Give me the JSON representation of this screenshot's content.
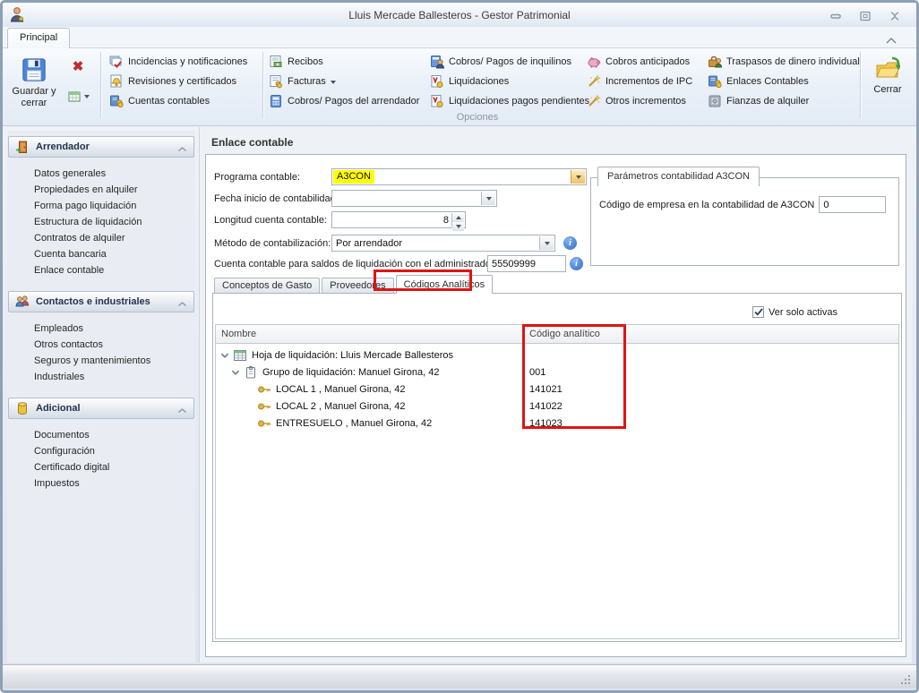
{
  "window": {
    "title": "Lluis Mercade Ballesteros - Gestor Patrimonial",
    "tab_label": "Principal"
  },
  "ribbon": {
    "save_label": "Guardar y cerrar",
    "close_label": "Cerrar",
    "group_label": "Opciones",
    "items": {
      "col_a": [
        "Incidencias y notificaciones",
        "Revisiones y certificados",
        "Cuentas contables"
      ],
      "col_b": [
        "Recibos",
        "Facturas",
        "Cobros/ Pagos del arrendador"
      ],
      "col_c": [
        "Cobros/ Pagos de inquilinos",
        "Liquidaciones",
        "Liquidaciones pagos pendientes"
      ],
      "col_d": [
        "Cobros anticipados",
        "Incrementos de IPC",
        "Otros incrementos"
      ],
      "col_e": [
        "Traspasos de dinero individual",
        "Enlaces Contables",
        "Fianzas de alquiler"
      ]
    }
  },
  "sidebar": {
    "groups": [
      {
        "label": "Arrendador",
        "items": [
          "Datos generales",
          "Propiedades en alquiler",
          "Forma pago liquidación",
          "Estructura de liquidación",
          "Contratos de alquiler",
          "Cuenta bancaria",
          "Enlace contable"
        ]
      },
      {
        "label": "Contactos e industriales",
        "items": [
          "Empleados",
          "Otros contactos",
          "Seguros y mantenimientos",
          "Industriales"
        ]
      },
      {
        "label": "Adicional",
        "items": [
          "Documentos",
          "Configuración",
          "Certificado digital",
          "Impuestos"
        ]
      }
    ]
  },
  "main": {
    "title": "Enlace contable",
    "form": {
      "programa_label": "Programa contable:",
      "programa_value": "A3CON",
      "fecha_label": "Fecha inicio de contabilidad:",
      "fecha_value": "",
      "longitud_label": "Longitud cuenta contable:",
      "longitud_value": "8",
      "metodo_label": "Método de contabilización:",
      "metodo_value": "Por arrendador",
      "cuenta_label": "Cuenta contable para saldos de liquidación con el administrador",
      "cuenta_value": "55509999"
    },
    "params_box": {
      "title": "Parámetros contabilidad A3CON",
      "codigo_label": "Código de empresa en la contabilidad de A3CON",
      "codigo_value": "0"
    },
    "tabs": [
      "Conceptos de Gasto",
      "Proveedores",
      "Códigos Analíticos"
    ],
    "active_tab": "Códigos Analíticos",
    "filter_checkbox": "Ver solo activas",
    "grid": {
      "columns": [
        "Nombre",
        "Código analítico"
      ],
      "rows": [
        {
          "name": "Hoja de liquidación: Lluis Mercade Ballesteros",
          "code": ""
        },
        {
          "name": "Grupo de liquidación: Manuel Girona, 42",
          "code": "001"
        },
        {
          "name": "LOCAL 1 , Manuel Girona, 42",
          "code": "141021"
        },
        {
          "name": "LOCAL 2 , Manuel Girona, 42",
          "code": "141022"
        },
        {
          "name": "ENTRESUELO , Manuel Girona, 42",
          "code": "141023"
        }
      ]
    }
  },
  "colors": {
    "highlight_yellow": "#ffff00",
    "annotation_red": "#de1414",
    "info_blue": "#2f6bc4"
  }
}
